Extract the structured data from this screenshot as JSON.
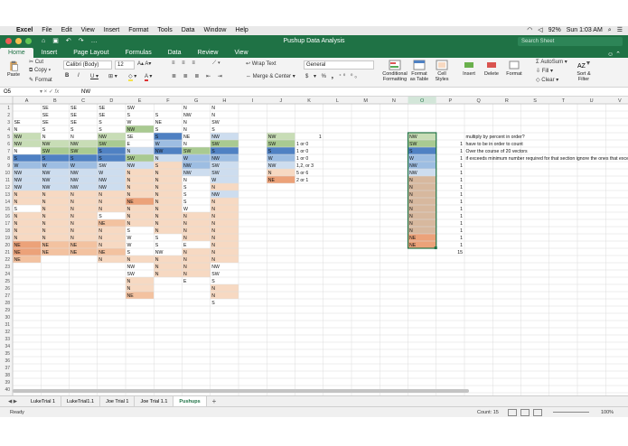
{
  "menubar": {
    "app": "Excel",
    "items": [
      "File",
      "Edit",
      "View",
      "Insert",
      "Format",
      "Tools",
      "Data",
      "Window",
      "Help"
    ],
    "battery": "92%",
    "clock": "Sun 1:03 AM"
  },
  "titlebar": {
    "title": "Pushup Data Analysis",
    "search_placeholder": "Search Sheet"
  },
  "ribbon_tabs": [
    "Home",
    "Insert",
    "Page Layout",
    "Formulas",
    "Data",
    "Review",
    "View"
  ],
  "ribbon": {
    "paste": "Paste",
    "cut": "Cut",
    "copy": "Copy",
    "format": "Format",
    "font": "Calibri (Body)",
    "size": "12",
    "wrap": "Wrap Text",
    "merge": "Merge & Center",
    "numfmt": "General",
    "cond": "Conditional Formatting",
    "fmt_table": "Format as Table",
    "cell_styles": "Cell Styles",
    "insert": "Insert",
    "delete": "Delete",
    "format_cells": "Format",
    "autosum": "AutoSum",
    "fill": "Fill",
    "clear": "Clear",
    "sort": "Sort & Filter"
  },
  "formula_bar": {
    "name_box": "O5",
    "fx": "fx",
    "value": "NW"
  },
  "columns": [
    "A",
    "B",
    "C",
    "D",
    "E",
    "F",
    "G",
    "H",
    "I",
    "J",
    "K",
    "L",
    "M",
    "N",
    "O",
    "P",
    "Q",
    "R",
    "S",
    "T",
    "U",
    "V"
  ],
  "col_widths": [
    14,
    31,
    31,
    31,
    31,
    31,
    31,
    31,
    31,
    31,
    31,
    31,
    31,
    31,
    31,
    31,
    31,
    31,
    31,
    31,
    31,
    31,
    31
  ],
  "colors": {
    "o1": "#f7d9c2",
    "o2": "#f3c2a0",
    "o3": "#eca279",
    "g1": "#c8ddb6",
    "g2": "#a9ca91",
    "b1": "#cdddef",
    "b2": "#9dbde2",
    "b3": "#4f81c3",
    "fill_sel": "#d7b89e"
  },
  "cells": [
    [
      1,
      1,
      "",
      "SE",
      "SE",
      "SE",
      "SW",
      "",
      "N",
      "N"
    ],
    [
      2,
      1,
      "",
      "SE",
      "SE",
      "SE",
      "S",
      "S",
      "NW",
      "N"
    ],
    [
      3,
      1,
      "SE",
      "SE",
      "SE",
      "S",
      "W",
      "NE",
      "N",
      "SW"
    ],
    [
      4,
      1,
      "N",
      "S",
      "S",
      "S",
      "NW",
      "S",
      "N",
      "S"
    ],
    [
      5,
      1,
      "NW",
      "N",
      "N",
      "NW",
      "SE",
      "S",
      "NE",
      "NW",
      "",
      "NW",
      "1",
      "",
      "",
      "",
      "NW",
      "",
      "multiply by percent in order?"
    ],
    [
      6,
      1,
      "NW",
      "NW",
      "NW",
      "SW",
      "E",
      "W",
      "N",
      "SW",
      "",
      "SW",
      "1 or 0",
      "",
      "",
      "",
      "SW",
      "1",
      "have to be in order to count"
    ],
    [
      7,
      1,
      "N",
      "SW",
      "SW",
      "S",
      "N",
      "NW",
      "SW",
      "S",
      "",
      "S",
      "1 or 0",
      "",
      "",
      "",
      "S",
      "1",
      "Over the course of 20 vectors"
    ],
    [
      8,
      1,
      "S",
      "S",
      "S",
      "S",
      "SW",
      "N",
      "W",
      "NW",
      "",
      "W",
      "1 or 0",
      "",
      "",
      "",
      "W",
      "1",
      "if exceeds minimum number required for that section ignore the ones that exceed"
    ],
    [
      9,
      1,
      "W",
      "W",
      "W",
      "SW",
      "NW",
      "S",
      "NW",
      "SW",
      "",
      "NW",
      "1,2, or 3",
      "",
      "",
      "",
      "NW",
      "1"
    ],
    [
      10,
      1,
      "NW",
      "NW",
      "NW",
      "W",
      "N",
      "N",
      "NW",
      "SW",
      "",
      "N",
      "5 or 6",
      "",
      "",
      "",
      "NW",
      "1"
    ],
    [
      11,
      1,
      "NW",
      "NW",
      "NW",
      "NW",
      "N",
      "N",
      "N",
      "W",
      "",
      "NE",
      "2 or 1",
      "",
      "",
      "",
      "N",
      "1"
    ],
    [
      12,
      1,
      "NW",
      "NW",
      "NW",
      "NW",
      "N",
      "N",
      "S",
      "N",
      "",
      "",
      "",
      "",
      "",
      "",
      "N",
      "1"
    ],
    [
      13,
      1,
      "N",
      "N",
      "N",
      "N",
      "N",
      "N",
      "S",
      "NW",
      "",
      "",
      "",
      "",
      "",
      "",
      "N",
      "1"
    ],
    [
      14,
      1,
      "N",
      "N",
      "N",
      "N",
      "NE",
      "N",
      "S",
      "N",
      "",
      "",
      "",
      "",
      "",
      "",
      "N",
      "1"
    ],
    [
      15,
      1,
      "S",
      "N",
      "N",
      "N",
      "N",
      "N",
      "W",
      "N",
      "",
      "",
      "",
      "",
      "",
      "",
      "N",
      "1"
    ],
    [
      16,
      1,
      "N",
      "N",
      "N",
      "S",
      "N",
      "N",
      "N",
      "N",
      "",
      "",
      "",
      "",
      "",
      "",
      "N",
      "1"
    ],
    [
      17,
      1,
      "N",
      "N",
      "N",
      "NE",
      "N",
      "N",
      "N",
      "N",
      "",
      "",
      "",
      "",
      "",
      "",
      "N",
      "1"
    ],
    [
      18,
      1,
      "N",
      "N",
      "N",
      "N",
      "S",
      "N",
      "N",
      "N",
      "",
      "",
      "",
      "",
      "",
      "",
      "N",
      "1"
    ],
    [
      19,
      1,
      "N",
      "N",
      "N",
      "N",
      "W",
      "S",
      "N",
      "N",
      "",
      "",
      "",
      "",
      "",
      "",
      "NE",
      "1"
    ],
    [
      20,
      1,
      "NE",
      "NE",
      "NE",
      "N",
      "W",
      "S",
      "E",
      "N",
      "",
      "",
      "",
      "",
      "",
      "",
      "NE",
      "1"
    ],
    [
      21,
      1,
      "NE",
      "NE",
      "NE",
      "NE",
      "S",
      "NW",
      "N",
      "N",
      "",
      "",
      "",
      "",
      "",
      "",
      "",
      "15"
    ],
    [
      22,
      1,
      "NE",
      "",
      "",
      "N",
      "N",
      "N",
      "N",
      "N"
    ],
    [
      23,
      1,
      "",
      "",
      "",
      "",
      "NW",
      "N",
      "N",
      "NW"
    ],
    [
      24,
      1,
      "",
      "",
      "",
      "",
      "SW",
      "N",
      "N",
      "SW"
    ],
    [
      25,
      1,
      "",
      "",
      "",
      "",
      "N",
      "",
      "E",
      "S"
    ],
    [
      26,
      1,
      "",
      "",
      "",
      "",
      "N",
      "",
      "",
      "N"
    ],
    [
      27,
      1,
      "",
      "",
      "",
      "",
      "NE",
      "",
      "",
      "N"
    ],
    [
      28,
      1,
      "",
      "",
      "",
      "",
      "",
      "",
      "",
      "S"
    ]
  ],
  "fills": [
    [
      5,
      1,
      "g1"
    ],
    [
      6,
      1,
      "g1"
    ],
    [
      5,
      4,
      "g1"
    ],
    [
      6,
      4,
      "g2"
    ],
    [
      4,
      5,
      "g2"
    ],
    [
      5,
      6,
      "b3"
    ],
    [
      6,
      6,
      "b2"
    ],
    [
      7,
      6,
      "b3"
    ],
    [
      5,
      8,
      "b1"
    ],
    [
      6,
      8,
      "g2"
    ],
    [
      7,
      8,
      "b3"
    ],
    [
      6,
      2,
      "g1"
    ],
    [
      6,
      3,
      "g1"
    ],
    [
      7,
      2,
      "g2"
    ],
    [
      7,
      3,
      "g2"
    ],
    [
      7,
      4,
      "b3"
    ],
    [
      7,
      5,
      "b1"
    ],
    [
      7,
      7,
      "g2"
    ],
    [
      8,
      1,
      "b3"
    ],
    [
      8,
      2,
      "b3"
    ],
    [
      8,
      3,
      "b3"
    ],
    [
      8,
      4,
      "b3"
    ],
    [
      8,
      5,
      "g2"
    ],
    [
      8,
      6,
      "b1"
    ],
    [
      8,
      7,
      "b2"
    ],
    [
      8,
      8,
      "b2"
    ],
    [
      9,
      1,
      "b2"
    ],
    [
      9,
      2,
      "b2"
    ],
    [
      9,
      3,
      "b2"
    ],
    [
      9,
      4,
      "b1"
    ],
    [
      9,
      5,
      "b1"
    ],
    [
      9,
      6,
      "o1"
    ],
    [
      9,
      7,
      "b2"
    ],
    [
      9,
      8,
      "b1"
    ],
    [
      10,
      1,
      "b1"
    ],
    [
      10,
      2,
      "b1"
    ],
    [
      10,
      3,
      "b1"
    ],
    [
      10,
      4,
      "b1"
    ],
    [
      10,
      5,
      "o1"
    ],
    [
      10,
      6,
      "o1"
    ],
    [
      10,
      7,
      "b1"
    ],
    [
      10,
      8,
      "b1"
    ],
    [
      11,
      1,
      "b1"
    ],
    [
      11,
      2,
      "b1"
    ],
    [
      11,
      3,
      "b1"
    ],
    [
      11,
      4,
      "b1"
    ],
    [
      11,
      5,
      "o1"
    ],
    [
      11,
      6,
      "o1"
    ],
    [
      11,
      8,
      "b1"
    ],
    [
      12,
      1,
      "b1"
    ],
    [
      12,
      2,
      "b1"
    ],
    [
      12,
      3,
      "b1"
    ],
    [
      12,
      4,
      "b1"
    ],
    [
      12,
      5,
      "o1"
    ],
    [
      12,
      6,
      "o1"
    ],
    [
      12,
      8,
      "o1"
    ],
    [
      13,
      1,
      "o1"
    ],
    [
      13,
      2,
      "o1"
    ],
    [
      13,
      3,
      "o1"
    ],
    [
      13,
      4,
      "o1"
    ],
    [
      13,
      5,
      "o1"
    ],
    [
      13,
      6,
      "o1"
    ],
    [
      13,
      8,
      "b1"
    ],
    [
      14,
      1,
      "o1"
    ],
    [
      14,
      2,
      "o1"
    ],
    [
      14,
      3,
      "o1"
    ],
    [
      14,
      4,
      "o1"
    ],
    [
      14,
      5,
      "o3"
    ],
    [
      14,
      6,
      "o1"
    ],
    [
      14,
      8,
      "o1"
    ],
    [
      15,
      2,
      "o1"
    ],
    [
      15,
      3,
      "o1"
    ],
    [
      15,
      4,
      "o1"
    ],
    [
      15,
      5,
      "o1"
    ],
    [
      15,
      6,
      "o1"
    ],
    [
      15,
      8,
      "o1"
    ],
    [
      16,
      1,
      "o1"
    ],
    [
      16,
      2,
      "o1"
    ],
    [
      16,
      3,
      "o1"
    ],
    [
      16,
      5,
      "o1"
    ],
    [
      16,
      6,
      "o1"
    ],
    [
      16,
      7,
      "o1"
    ],
    [
      16,
      8,
      "o1"
    ],
    [
      17,
      1,
      "o1"
    ],
    [
      17,
      2,
      "o1"
    ],
    [
      17,
      3,
      "o1"
    ],
    [
      17,
      4,
      "o2"
    ],
    [
      17,
      5,
      "o1"
    ],
    [
      17,
      6,
      "o1"
    ],
    [
      17,
      7,
      "o1"
    ],
    [
      17,
      8,
      "o1"
    ],
    [
      18,
      1,
      "o1"
    ],
    [
      18,
      2,
      "o1"
    ],
    [
      18,
      3,
      "o1"
    ],
    [
      18,
      4,
      "o1"
    ],
    [
      18,
      6,
      "o1"
    ],
    [
      18,
      7,
      "o1"
    ],
    [
      18,
      8,
      "o1"
    ],
    [
      19,
      1,
      "o1"
    ],
    [
      19,
      2,
      "o1"
    ],
    [
      19,
      3,
      "o1"
    ],
    [
      19,
      4,
      "o1"
    ],
    [
      19,
      7,
      "o1"
    ],
    [
      19,
      8,
      "o1"
    ],
    [
      20,
      1,
      "o3"
    ],
    [
      20,
      2,
      "o2"
    ],
    [
      20,
      3,
      "o2"
    ],
    [
      20,
      4,
      "o1"
    ],
    [
      20,
      8,
      "o1"
    ],
    [
      21,
      1,
      "o3"
    ],
    [
      21,
      2,
      "o2"
    ],
    [
      21,
      3,
      "o2"
    ],
    [
      21,
      4,
      "o2"
    ],
    [
      21,
      7,
      "o1"
    ],
    [
      21,
      8,
      "o1"
    ],
    [
      22,
      1,
      "o2"
    ],
    [
      22,
      4,
      "o1"
    ],
    [
      22,
      5,
      "o1"
    ],
    [
      22,
      6,
      "o1"
    ],
    [
      22,
      7,
      "o1"
    ],
    [
      22,
      8,
      "o1"
    ],
    [
      23,
      6,
      "o1"
    ],
    [
      23,
      7,
      "o1"
    ],
    [
      24,
      6,
      "o1"
    ],
    [
      24,
      7,
      "o1"
    ],
    [
      25,
      5,
      "o1"
    ],
    [
      26,
      5,
      "o1"
    ],
    [
      26,
      8,
      "o1"
    ],
    [
      27,
      5,
      "o2"
    ],
    [
      27,
      8,
      "o1"
    ],
    [
      5,
      10,
      "g1"
    ],
    [
      6,
      10,
      "g2"
    ],
    [
      7,
      10,
      "b3"
    ],
    [
      8,
      10,
      "b2"
    ],
    [
      9,
      10,
      "b1"
    ],
    [
      10,
      10,
      "o1"
    ],
    [
      11,
      10,
      "o3"
    ],
    [
      5,
      15,
      "g1"
    ],
    [
      6,
      15,
      "g2"
    ],
    [
      7,
      15,
      "b3"
    ],
    [
      8,
      15,
      "b2"
    ],
    [
      9,
      15,
      "b2"
    ],
    [
      10,
      15,
      "b1"
    ],
    [
      11,
      15,
      "fill_sel"
    ],
    [
      12,
      15,
      "fill_sel"
    ],
    [
      13,
      15,
      "fill_sel"
    ],
    [
      14,
      15,
      "fill_sel"
    ],
    [
      15,
      15,
      "fill_sel"
    ],
    [
      16,
      15,
      "fill_sel"
    ],
    [
      17,
      15,
      "fill_sel"
    ],
    [
      18,
      15,
      "fill_sel"
    ],
    [
      19,
      15,
      "o3"
    ],
    [
      20,
      15,
      "o3"
    ]
  ],
  "sheet_tabs": [
    "LukeTrial 1",
    "LukeTrial1.1",
    "Joe Trial 1",
    "Joe Trial 1.1",
    "Pushups"
  ],
  "status": {
    "ready": "Ready",
    "count": "Count: 15",
    "zoom": "100%"
  }
}
